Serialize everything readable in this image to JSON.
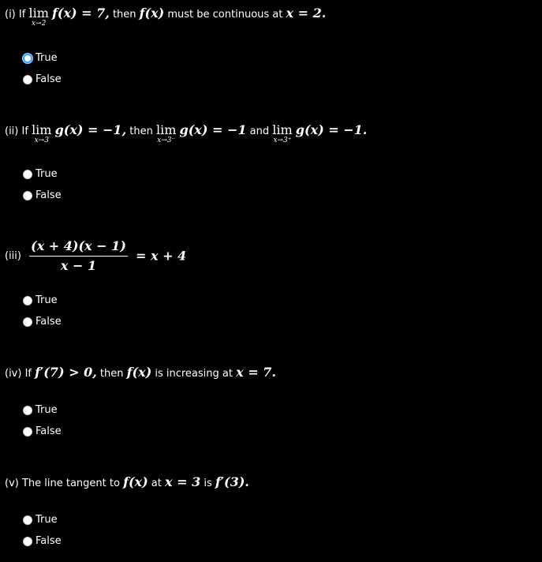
{
  "options": {
    "true_label": "True",
    "false_label": "False"
  },
  "q1": {
    "prefix": "(i) If",
    "lim": "lim",
    "lim_sub": "x→2",
    "expr1": "f(x) = 7,",
    "mid": "then",
    "expr2": "f(x)",
    "text2": "must be continuous at",
    "expr3": "x = 2."
  },
  "q2": {
    "prefix": "(ii) If",
    "lim": "lim",
    "lim_sub": "x→3",
    "expr1": "g(x) = −1,",
    "mid": "then",
    "lim2": "lim",
    "lim2_sub": "x→3⁻",
    "expr2": "g(x) = −1",
    "and": "and",
    "lim3": "lim",
    "lim3_sub": "x→3⁺",
    "expr3": "g(x) = −1."
  },
  "q3": {
    "prefix": "(iii)",
    "numerator": "(x + 4)(x − 1)",
    "denominator": "x − 1",
    "rhs": "= x + 4"
  },
  "q4": {
    "prefix": "(iv) If",
    "expr1": "f′(7) > 0,",
    "mid": "then",
    "expr2": "f(x)",
    "text2": "is increasing at",
    "expr3": "x = 7."
  },
  "q5": {
    "prefix": "(v) The line tangent to",
    "expr1": "f(x)",
    "mid": "at",
    "expr2": "x = 3",
    "text2": "is",
    "expr3": "f′(3)."
  }
}
